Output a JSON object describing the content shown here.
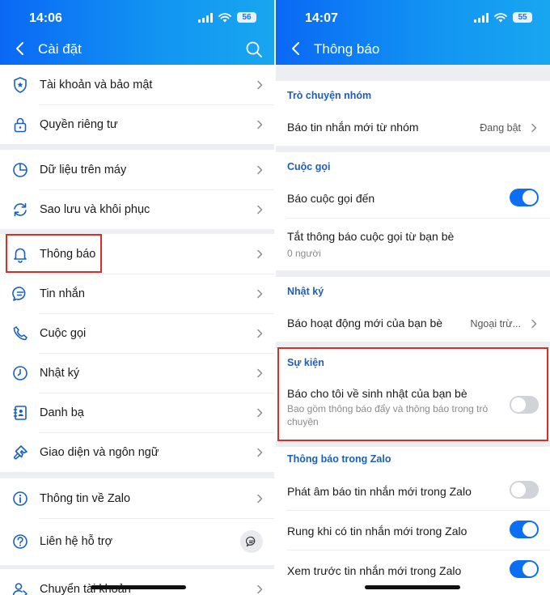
{
  "left": {
    "status_time": "14:06",
    "battery": "56",
    "title": "Cài đặt",
    "groups": [
      [
        {
          "label": "Tài khoản và bảo mật",
          "icon": "shield-icon"
        },
        {
          "label": "Quyền riêng tư",
          "icon": "lock-icon"
        }
      ],
      [
        {
          "label": "Dữ liệu trên máy",
          "icon": "pie-chart-icon"
        },
        {
          "label": "Sao lưu và khôi phục",
          "icon": "sync-icon"
        }
      ],
      [
        {
          "label": "Thông báo",
          "icon": "bell-icon"
        },
        {
          "label": "Tin nhắn",
          "icon": "message-icon"
        },
        {
          "label": "Cuộc gọi",
          "icon": "phone-icon"
        },
        {
          "label": "Nhật ký",
          "icon": "clock-icon"
        },
        {
          "label": "Danh bạ",
          "icon": "contacts-icon"
        },
        {
          "label": "Giao diện và ngôn ngữ",
          "icon": "paintbrush-icon"
        }
      ],
      [
        {
          "label": "Thông tin về Zalo",
          "icon": "info-icon"
        },
        {
          "label": "Liên hệ hỗ trợ",
          "icon": "help-icon"
        }
      ],
      [
        {
          "label": "Chuyển tài khoản",
          "icon": "switch-account-icon"
        }
      ]
    ]
  },
  "right": {
    "status_time": "14:07",
    "battery": "55",
    "title": "Thông báo",
    "group_chat": {
      "title": "Trò chuyện nhóm",
      "item": "Báo tin nhắn mới từ nhóm",
      "value": "Đang bật"
    },
    "calls": {
      "title": "Cuộc gọi",
      "incoming": "Báo cuộc gọi đến",
      "incoming_on": true,
      "mute_friends": "Tắt thông báo cuộc gọi từ bạn bè",
      "mute_friends_sub": "0 người"
    },
    "diary": {
      "title": "Nhật ký",
      "item": "Báo hoạt động mới của bạn bè",
      "value": "Ngoại trừ..."
    },
    "events": {
      "title": "Sự kiện",
      "item": "Báo cho tôi về sinh nhật của bạn bè",
      "sub": "Bao gồm thông báo đẩy và thông báo trong trò chuyện",
      "on": false
    },
    "in_app": {
      "title": "Thông báo trong Zalo",
      "sound": "Phát âm báo tin nhắn mới trong Zalo",
      "sound_on": false,
      "vibrate": "Rung khi có tin nhắn mới trong Zalo",
      "vibrate_on": true,
      "preview": "Xem trước tin nhắn mới trong Zalo",
      "preview_on": true
    }
  },
  "colors": {
    "accent": "#0b6ef3",
    "section_title": "#1d5fb8",
    "highlight": "#e02a22",
    "icon": "#1a5fc4"
  }
}
